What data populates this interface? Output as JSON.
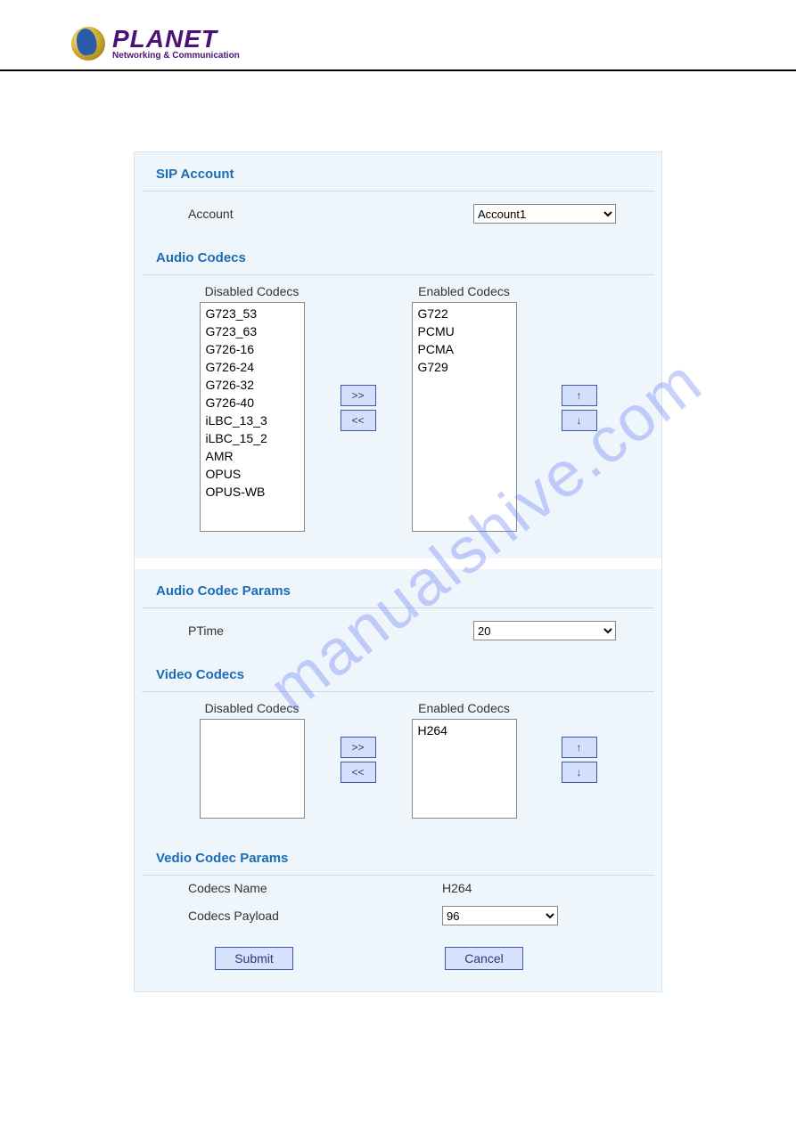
{
  "brand": {
    "name": "PLANET",
    "tagline": "Networking & Communication"
  },
  "watermark": "manualshive.com",
  "sections": {
    "sip": {
      "title": "SIP Account",
      "account_label": "Account",
      "account_value": "Account1"
    },
    "audio_codecs": {
      "title": "Audio Codecs",
      "disabled_label": "Disabled Codecs",
      "enabled_label": "Enabled Codecs",
      "disabled": [
        "G723_53",
        "G723_63",
        "G726-16",
        "G726-24",
        "G726-32",
        "G726-40",
        "iLBC_13_3",
        "iLBC_15_2",
        "AMR",
        "OPUS",
        "OPUS-WB"
      ],
      "enabled": [
        "G722",
        "PCMU",
        "PCMA",
        "G729"
      ]
    },
    "audio_params": {
      "title": "Audio Codec Params",
      "ptime_label": "PTime",
      "ptime_value": "20"
    },
    "video_codecs": {
      "title": "Video Codecs",
      "disabled_label": "Disabled Codecs",
      "enabled_label": "Enabled Codecs",
      "disabled": [],
      "enabled": [
        "H264"
      ]
    },
    "video_params": {
      "title": "Vedio Codec Params",
      "name_label": "Codecs Name",
      "name_value": "H264",
      "payload_label": "Codecs Payload",
      "payload_value": "96"
    }
  },
  "buttons": {
    "move_right": ">>",
    "move_left": "<<",
    "move_up": "↑",
    "move_down": "↓",
    "submit": "Submit",
    "cancel": "Cancel"
  }
}
